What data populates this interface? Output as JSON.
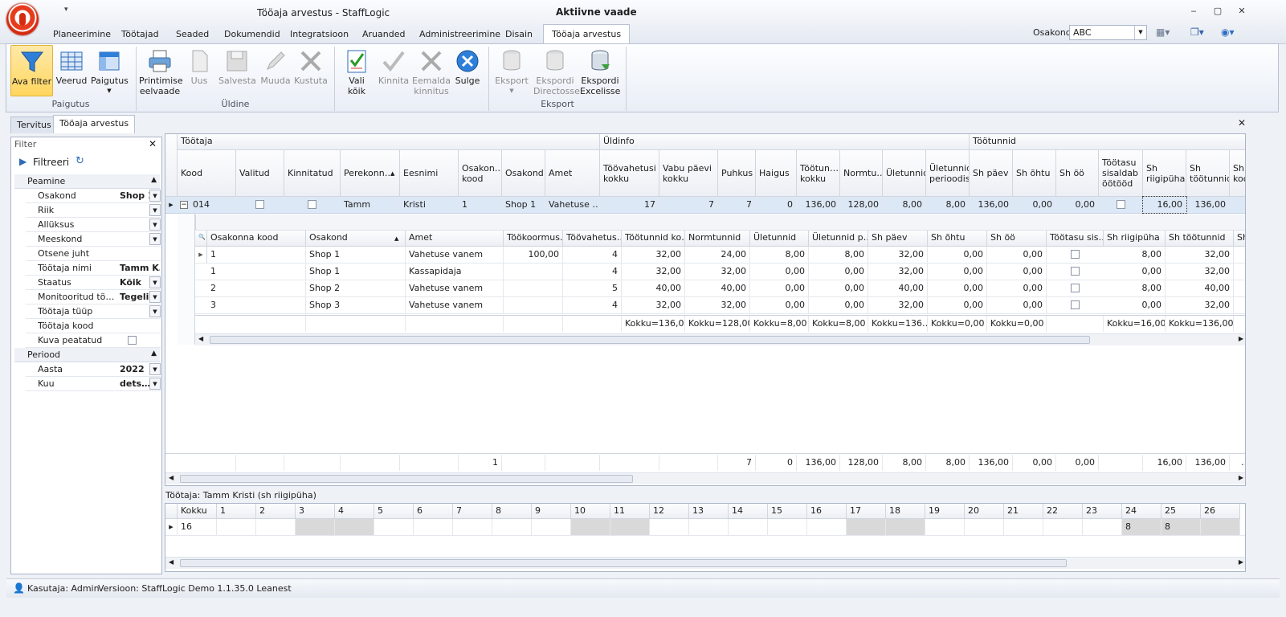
{
  "window": {
    "title": "Tööaja arvestus - StaffLogic",
    "active_view": "Aktiivne vaade",
    "qat": "▾"
  },
  "menu_tabs": [
    {
      "label": "Planeerimine"
    },
    {
      "label": "Töötajad"
    },
    {
      "label": "Seaded"
    },
    {
      "label": "Dokumendid"
    },
    {
      "label": "Integratsioon"
    },
    {
      "label": "Aruanded"
    },
    {
      "label": "Administreerimine"
    },
    {
      "label": "Disain"
    },
    {
      "label": "Tööaja arvestus"
    }
  ],
  "osakond": {
    "label": "Osakond",
    "value": "ABC"
  },
  "ribbon": {
    "buttons": [
      {
        "label": "Ava filter"
      },
      {
        "label": "Veerud"
      },
      {
        "label": "Paigutus"
      },
      {
        "label": "Printimise eelvaade"
      },
      {
        "label": "Uus"
      },
      {
        "label": "Salvesta"
      },
      {
        "label": "Muuda"
      },
      {
        "label": "Kustuta"
      },
      {
        "label": "Vali kõik"
      },
      {
        "label": "Kinnita"
      },
      {
        "label": "Eemalda kinnitus"
      },
      {
        "label": "Sulge"
      },
      {
        "label": "Eksport"
      },
      {
        "label": "Ekspordi Directosse"
      },
      {
        "label": "Ekspordi Excelisse"
      }
    ],
    "groups": [
      {
        "label": "Paigutus"
      },
      {
        "label": "Üldine"
      },
      {
        "label": "Eksport"
      }
    ]
  },
  "doc_tabs": [
    {
      "label": "Tervitus"
    },
    {
      "label": "Tööaja arvestus"
    }
  ],
  "filter": {
    "title": "Filter",
    "apply": "Filtreeri",
    "cat_main": "Peamine",
    "cat_period": "Periood",
    "rows": [
      {
        "label": "Osakond",
        "value": "Shop 1"
      },
      {
        "label": "Riik",
        "value": ""
      },
      {
        "label": "Allüksus",
        "value": ""
      },
      {
        "label": "Meeskond",
        "value": ""
      },
      {
        "label": "Otsene juht",
        "value": ""
      },
      {
        "label": "Töötaja nimi",
        "value": "Tamm K…"
      },
      {
        "label": "Staatus",
        "value": "Kõik"
      },
      {
        "label": "Monitooritud tö…",
        "value": "Tegelik"
      },
      {
        "label": "Töötaja tüüp",
        "value": ""
      },
      {
        "label": "Töötaja kood",
        "value": ""
      },
      {
        "label": "Kuva peatatud",
        "value": ""
      }
    ],
    "period": [
      {
        "label": "Aasta",
        "value": "2022"
      },
      {
        "label": "Kuu",
        "value": "dets…"
      }
    ]
  },
  "grid": {
    "bands": [
      {
        "label": "Töötaja"
      },
      {
        "label": "Üldinfo"
      },
      {
        "label": "Töötunnid"
      }
    ],
    "cols": [
      {
        "label": "Kood"
      },
      {
        "label": "Valitud"
      },
      {
        "label": "Kinnitatud"
      },
      {
        "label": "Perekonn…"
      },
      {
        "label": "Eesnimi"
      },
      {
        "label": "Osakon… kood"
      },
      {
        "label": "Osakond"
      },
      {
        "label": "Amet"
      },
      {
        "label": "Töövahetusi kokku"
      },
      {
        "label": "Vabu päevi kokku"
      },
      {
        "label": "Puhkus"
      },
      {
        "label": "Haigus"
      },
      {
        "label": "Töötun… kokku"
      },
      {
        "label": "Normtu…"
      },
      {
        "label": "Ületunnid"
      },
      {
        "label": "Ületunnid perioodis"
      },
      {
        "label": "Sh päev"
      },
      {
        "label": "Sh õhtu"
      },
      {
        "label": "Sh öö"
      },
      {
        "label": "Töötasu sisaldab öötööd"
      },
      {
        "label": "Sh riigipüha"
      },
      {
        "label": "Sh töötunnid"
      },
      {
        "label": "Sh koo"
      }
    ],
    "row": {
      "cells": [
        "014",
        "",
        "",
        "Tamm",
        "Kristi",
        "1",
        "Shop 1",
        "Vahetuse …",
        "17",
        "7",
        "7",
        "0",
        "136,00",
        "128,00",
        "8,00",
        "8,00",
        "136,00",
        "0,00",
        "0,00",
        "",
        "16,00",
        "136,00",
        ""
      ]
    },
    "detail_cols": [
      {
        "label": "Osakonna kood"
      },
      {
        "label": "Osakond"
      },
      {
        "label": "Amet"
      },
      {
        "label": "Töökoormus…"
      },
      {
        "label": "Töövahetus…"
      },
      {
        "label": "Töötunnid ko…"
      },
      {
        "label": "Normtunnid"
      },
      {
        "label": "Ületunnid"
      },
      {
        "label": "Ületunnid p…"
      },
      {
        "label": "Sh päev"
      },
      {
        "label": "Sh õhtu"
      },
      {
        "label": "Sh öö"
      },
      {
        "label": "Töötasu sis…"
      },
      {
        "label": "Sh riigipüha"
      },
      {
        "label": "Sh töötunnid"
      },
      {
        "label": "Sh"
      }
    ],
    "detail_rows": [
      {
        "cells": [
          "1",
          "Shop 1",
          "Vahetuse vanem",
          "100,00",
          "4",
          "32,00",
          "24,00",
          "8,00",
          "8,00",
          "32,00",
          "0,00",
          "0,00",
          "",
          "8,00",
          "32,00"
        ]
      },
      {
        "cells": [
          "1",
          "Shop 1",
          "Kassapidaja",
          "",
          "4",
          "32,00",
          "32,00",
          "0,00",
          "0,00",
          "32,00",
          "0,00",
          "0,00",
          "",
          "0,00",
          "32,00"
        ]
      },
      {
        "cells": [
          "2",
          "Shop 2",
          "Vahetuse vanem",
          "",
          "5",
          "40,00",
          "40,00",
          "0,00",
          "0,00",
          "40,00",
          "0,00",
          "0,00",
          "",
          "8,00",
          "40,00"
        ]
      },
      {
        "cells": [
          "3",
          "Shop 3",
          "Vahetuse vanem",
          "",
          "4",
          "32,00",
          "32,00",
          "0,00",
          "0,00",
          "32,00",
          "0,00",
          "0,00",
          "",
          "0,00",
          "32,00"
        ]
      }
    ],
    "detail_totals": [
      "",
      "",
      "",
      "",
      "",
      "Kokku=136,00",
      "Kokku=128,00",
      "Kokku=8,00",
      "Kokku=8,00",
      "Kokku=136…",
      "Kokku=0,00",
      "Kokku=0,00",
      "",
      "Kokku=16,00",
      "Kokku=136,00"
    ],
    "footer": [
      "",
      "",
      "",
      "",
      "",
      "1",
      "",
      "",
      "",
      "",
      "7",
      "0",
      "136,00",
      "128,00",
      "8,00",
      "8,00",
      "136,00",
      "0,00",
      "0,00",
      "",
      "16,00",
      "136,00",
      "…"
    ]
  },
  "bottom": {
    "caption": "Töötaja: Tamm Kristi (sh riigipüha)",
    "header": [
      "Kokku",
      "1",
      "2",
      "3",
      "4",
      "5",
      "6",
      "7",
      "8",
      "9",
      "10",
      "11",
      "12",
      "13",
      "14",
      "15",
      "16",
      "17",
      "18",
      "19",
      "20",
      "21",
      "22",
      "23",
      "24",
      "25",
      "26"
    ],
    "row": [
      "16",
      "",
      "",
      "",
      "",
      "",
      "",
      "",
      "",
      "",
      "",
      "",
      "",
      "",
      "",
      "",
      "",
      "",
      "",
      "",
      "",
      "",
      "",
      "",
      "8",
      "8",
      ""
    ]
  },
  "status": {
    "user": "Kasutaja: Admin",
    "version": "Versioon: StaffLogic Demo 1.1.35.0 Leanest"
  }
}
